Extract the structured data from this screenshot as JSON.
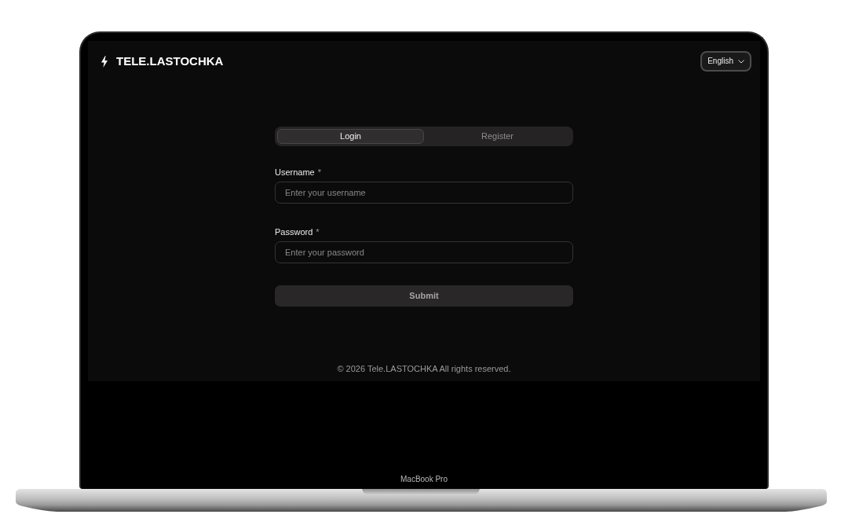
{
  "device": {
    "label": "MacBook Pro"
  },
  "header": {
    "brand": "TELE.LASTOCHKA",
    "language": "English"
  },
  "tabs": [
    {
      "label": "Login",
      "selected": true
    },
    {
      "label": "Register",
      "selected": false
    }
  ],
  "fields": [
    {
      "label": "Username",
      "required_mark": "*",
      "placeholder": "Enter your username"
    },
    {
      "label": "Password",
      "required_mark": "*",
      "placeholder": "Enter your password"
    }
  ],
  "submit": {
    "label": "Submit"
  },
  "footer": {
    "text": "© 2026 Tele.LASTOCHKA All rights reserved."
  }
}
